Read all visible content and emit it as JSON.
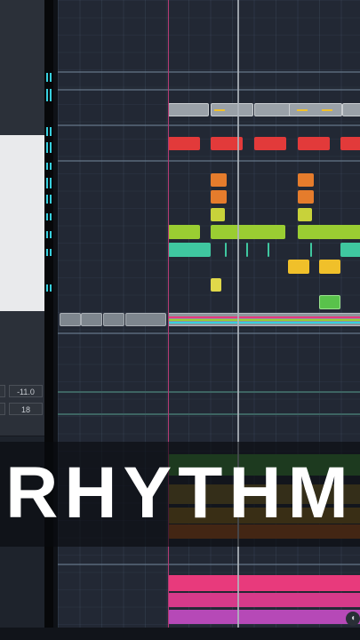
{
  "title": "RHYTHM",
  "track_header_values": {
    "volume": "-11.0",
    "pan": "18"
  },
  "colors": {
    "red": "#e23a3a",
    "orange": "#e57c2c",
    "lime": "#9acd32",
    "teal": "#3fc7a0",
    "yellow": "#f0c02a",
    "green": "#59c24b",
    "gray": "#8d949c",
    "pink": "#e83a7c",
    "magenta": "#b649b7",
    "cyan": "#38d0df"
  },
  "icons": [
    "speaker-icon",
    "gear-icon",
    "dropdown-arrow-icon"
  ]
}
